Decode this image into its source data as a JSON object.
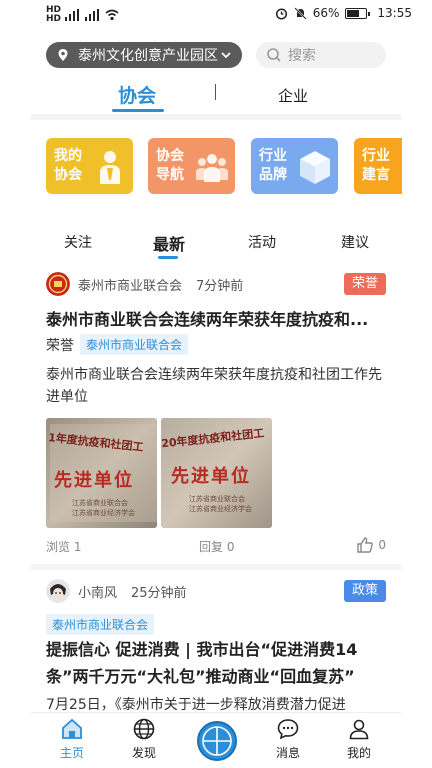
{
  "status": {
    "battery": "66%",
    "time": "13:55",
    "battery_level": 0.66
  },
  "location": {
    "label": "泰州文化创意产业园区"
  },
  "search": {
    "placeholder": "搜索"
  },
  "top_tabs": [
    {
      "label": "协会",
      "active": true
    },
    {
      "label": "企业",
      "active": false
    }
  ],
  "feature_cards": [
    {
      "line1": "我的",
      "line2": "协会",
      "color": "#f0c02a",
      "icon": "person-icon"
    },
    {
      "line1": "协会",
      "line2": "导航",
      "color": "#f29667",
      "icon": "group-icon"
    },
    {
      "line1": "行业",
      "line2": "品牌",
      "color": "#79a9ee",
      "icon": "cube-icon"
    },
    {
      "line1": "行业",
      "line2": "建言",
      "color": "#f7a51e",
      "icon": "bulb-icon"
    }
  ],
  "sub_tabs": [
    {
      "label": "关注",
      "active": false
    },
    {
      "label": "最新",
      "active": true
    },
    {
      "label": "活动",
      "active": false
    },
    {
      "label": "建议",
      "active": false
    }
  ],
  "posts": [
    {
      "author": "泰州市商业联合会",
      "time": "7分钟前",
      "tag": "荣誉",
      "tag_color": "#f06a5a",
      "title": "泰州市商业联合会连续两年荣获年度抗疫和...",
      "category": "荣誉",
      "org": "泰州市商业联合会",
      "body": "泰州市商业联合会连续两年荣获年度抗疫和社团工作先进单位",
      "images": [
        {
          "top": "1年度抗疫和社团工",
          "main": "先进单位",
          "small": "江苏省商业联合会",
          "small2": "江苏省商业经济学会"
        },
        {
          "top": "20年度抗疫和社团工",
          "main": "先进单位",
          "small": "江苏省商业联合会",
          "small2": "江苏省商业经济学会"
        }
      ],
      "views": "浏览 1",
      "replies": "回复 0",
      "likes": "0"
    },
    {
      "author": "小南风",
      "time": "25分钟前",
      "tag": "政策",
      "tag_color": "#4a8ae8",
      "org": "泰州市商业联合会",
      "title": "提振信心 促进消费 | 我市出台“促进消费14条”两千万元“大礼包”推动商业“回血复苏”",
      "body": "7月25日，《泰州市关于进一步释放消费潜力促进"
    }
  ],
  "bottom_nav": [
    {
      "label": "主页",
      "icon": "home-icon",
      "active": true
    },
    {
      "label": "发现",
      "icon": "globe-icon",
      "active": false
    },
    {
      "label": "消息",
      "icon": "message-icon",
      "active": false
    },
    {
      "label": "我的",
      "icon": "user-icon",
      "active": false
    }
  ]
}
